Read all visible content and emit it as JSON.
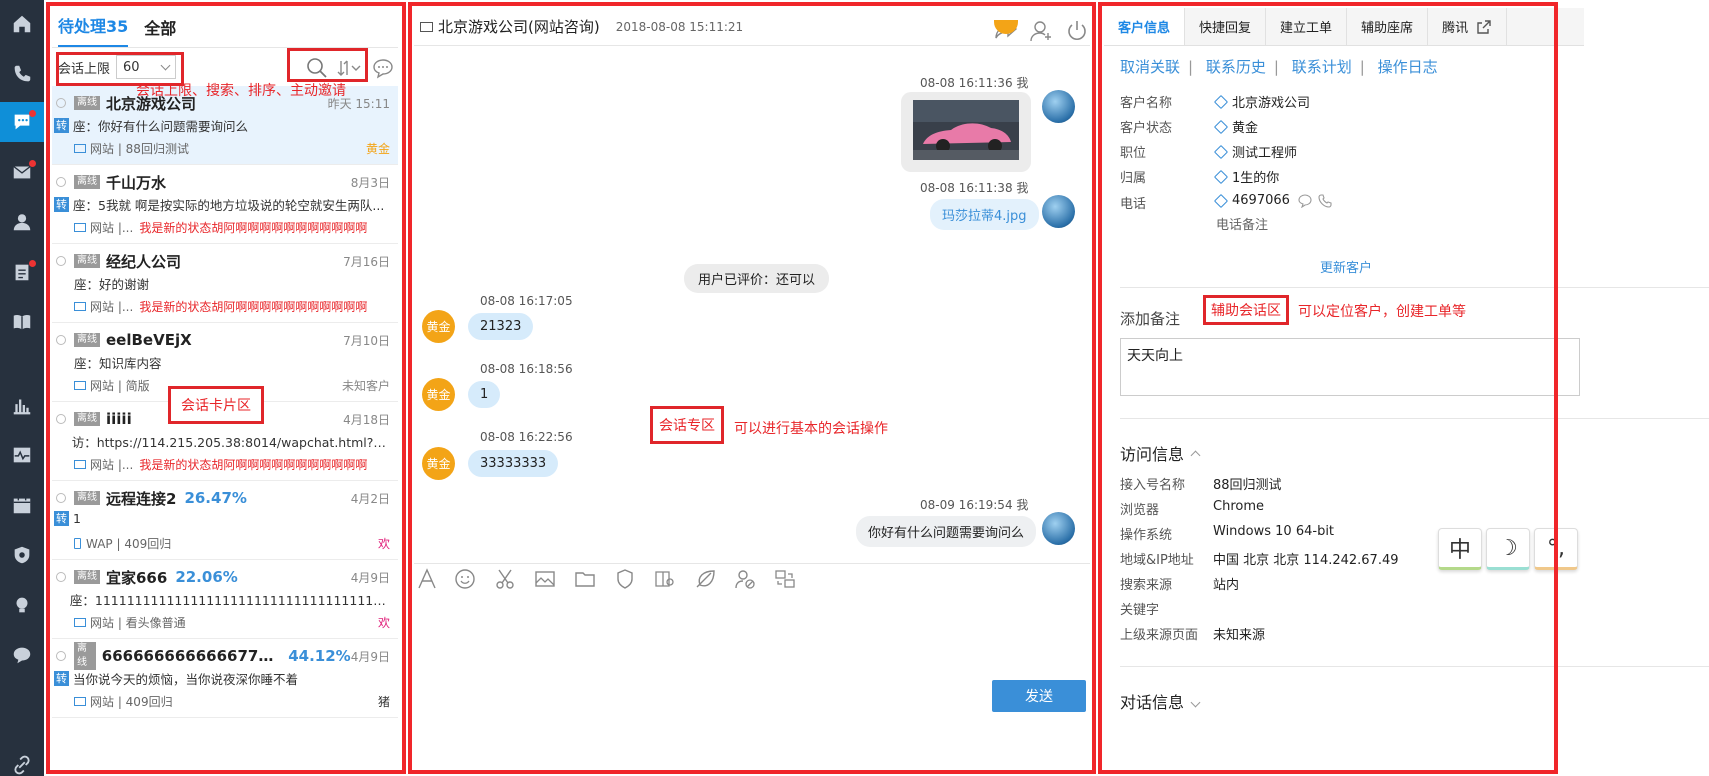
{
  "nav": {
    "icons": [
      "home-icon",
      "phone-icon",
      "chat-icon",
      "mail-icon",
      "user-icon",
      "clipboard-icon",
      "book-icon",
      "bar-chart-icon",
      "pulse-icon",
      "calendar-icon",
      "shield-icon",
      "bulb-icon",
      "comment-icon",
      "link-icon"
    ],
    "active_color": "#0f8fd8",
    "bg_color": "#27313e"
  },
  "left": {
    "tab_pending": "待处理35",
    "tab_all": "全部",
    "limit_label": "会话上限",
    "limit_value": "60",
    "toolbar_note": "会话上限、搜索、排序、主动邀请",
    "card_area_label": "会话卡片区",
    "cards": [
      {
        "status": "离线",
        "name": "北京游戏公司",
        "pct": "",
        "date": "昨天 15:11",
        "zhuan": "转",
        "msg": "座：你好有什么问题需要询问么",
        "channel": "网站 | 88回归测试",
        "state": "",
        "tag": "黄金",
        "tag_color": "#f3a417",
        "device": "pc"
      },
      {
        "status": "离线",
        "name": "千山万水",
        "pct": "",
        "date": "8月3日",
        "zhuan": "转",
        "msg": "座：5我就 啊是按实际的地方垃圾说的轮空就安生两队...",
        "channel": "网站 |...",
        "state": "我是新的状态胡阿啊啊啊啊啊啊啊啊啊啊啊",
        "tag": "",
        "tag_color": "",
        "device": "pc"
      },
      {
        "status": "离线",
        "name": "经纪人公司",
        "pct": "",
        "date": "7月16日",
        "zhuan": "",
        "msg": "座：好的谢谢",
        "channel": "网站 |...",
        "state": "我是新的状态胡阿啊啊啊啊啊啊啊啊啊啊啊",
        "tag": "",
        "tag_color": "",
        "device": "pc"
      },
      {
        "status": "离线",
        "name": "eelBeVEjX",
        "pct": "",
        "date": "7月10日",
        "zhuan": "",
        "msg": "座：知识库内容",
        "channel": "网站 | 简版",
        "state": "",
        "tag": "未知客户",
        "tag_color": "#888888",
        "device": "pc"
      },
      {
        "status": "离线",
        "name": "iiiii",
        "pct": "",
        "date": "4月18日",
        "zhuan": "",
        "msg": "访：https://114.215.205.38:8014/wapchat.html?accessI...",
        "channel": "网站 |...",
        "state": "我是新的状态胡阿啊啊啊啊啊啊啊啊啊啊啊",
        "tag": "",
        "tag_color": "",
        "device": "pc"
      },
      {
        "status": "离线",
        "name": "远程连接2",
        "pct": "26.47%",
        "date": "4月2日",
        "zhuan": "转",
        "msg": "1",
        "channel": "WAP | 409回归",
        "state": "",
        "tag": "欢",
        "tag_color": "#e0207a",
        "device": "phone"
      },
      {
        "status": "离线",
        "name": "宜家666",
        "pct": "22.06%",
        "date": "4月9日",
        "zhuan": "",
        "msg": "座：1111111111111111111111111111111111111111111111...",
        "channel": "网站 | 看头像普通",
        "state": "",
        "tag": "欢",
        "tag_color": "#e0207a",
        "device": "pc"
      },
      {
        "status": "离线",
        "name": "66666666666667777777...",
        "pct": "44.12%",
        "date": "4月9日",
        "zhuan": "转",
        "msg": "当你说今天的烦恼，当你说夜深你睡不着",
        "channel": "网站 | 409回归",
        "state": "",
        "tag": "猪",
        "tag_color": "#333333",
        "device": "pc"
      }
    ]
  },
  "chat": {
    "title": "北京游戏公司(网站咨询)",
    "datetime": "2018-08-08 15:11:21",
    "messages": [
      {
        "time": "08-08 16:11:36 我"
      },
      {
        "time": "08-08 16:11:38 我",
        "file": "玛莎拉蒂4.jpg"
      },
      {
        "rating": "用户已评价：还可以"
      },
      {
        "time": "08-08 16:17:05",
        "avatar": "黄金",
        "text": "21323"
      },
      {
        "time": "08-08 16:18:56",
        "avatar": "黄金",
        "text": "1"
      },
      {
        "time": "08-08 16:22:56",
        "avatar": "黄金",
        "text": "33333333"
      },
      {
        "time": "08-09 16:19:54 我",
        "text": "你好有什么问题需要询问么"
      }
    ],
    "area_label": "会话专区",
    "area_note": "可以进行基本的会话操作",
    "send_label": "发送"
  },
  "right": {
    "tabs": [
      "客户信息",
      "快捷回复",
      "建立工单",
      "辅助座席",
      "腾讯"
    ],
    "links": [
      "取消关联",
      "联系历史",
      "联系计划",
      "操作日志"
    ],
    "fields": [
      {
        "label": "客户名称",
        "value": "北京游戏公司"
      },
      {
        "label": "客户状态",
        "value": "黄金"
      },
      {
        "label": "职位",
        "value": "测试工程师"
      },
      {
        "label": "归属",
        "value": "1生的你"
      },
      {
        "label": "电话",
        "value": "4697066"
      }
    ],
    "phone_note": "电话备注",
    "update_label": "更新客户",
    "add_note_label": "添加备注",
    "assist_label": "辅助会话区",
    "assist_note": "可以定位客户，创建工单等",
    "note_value": "天天向上",
    "visit_title": "访问信息",
    "visit": [
      {
        "label": "接入号名称",
        "value": "88回归测试"
      },
      {
        "label": "浏览器",
        "value": "Chrome"
      },
      {
        "label": "操作系统",
        "value": "Windows 10 64-bit"
      },
      {
        "label": "地域&IP地址",
        "value": "中国 北京 北京 114.242.67.49"
      },
      {
        "label": "搜索来源",
        "value": "站内"
      },
      {
        "label": "关键字",
        "value": ""
      },
      {
        "label": "上级来源页面",
        "value": "未知来源"
      }
    ],
    "dialog_title": "对话信息",
    "ime": [
      "中",
      "☽",
      "°,"
    ]
  },
  "accent": "#3a8fd8",
  "annotation_color": "#e8262a"
}
